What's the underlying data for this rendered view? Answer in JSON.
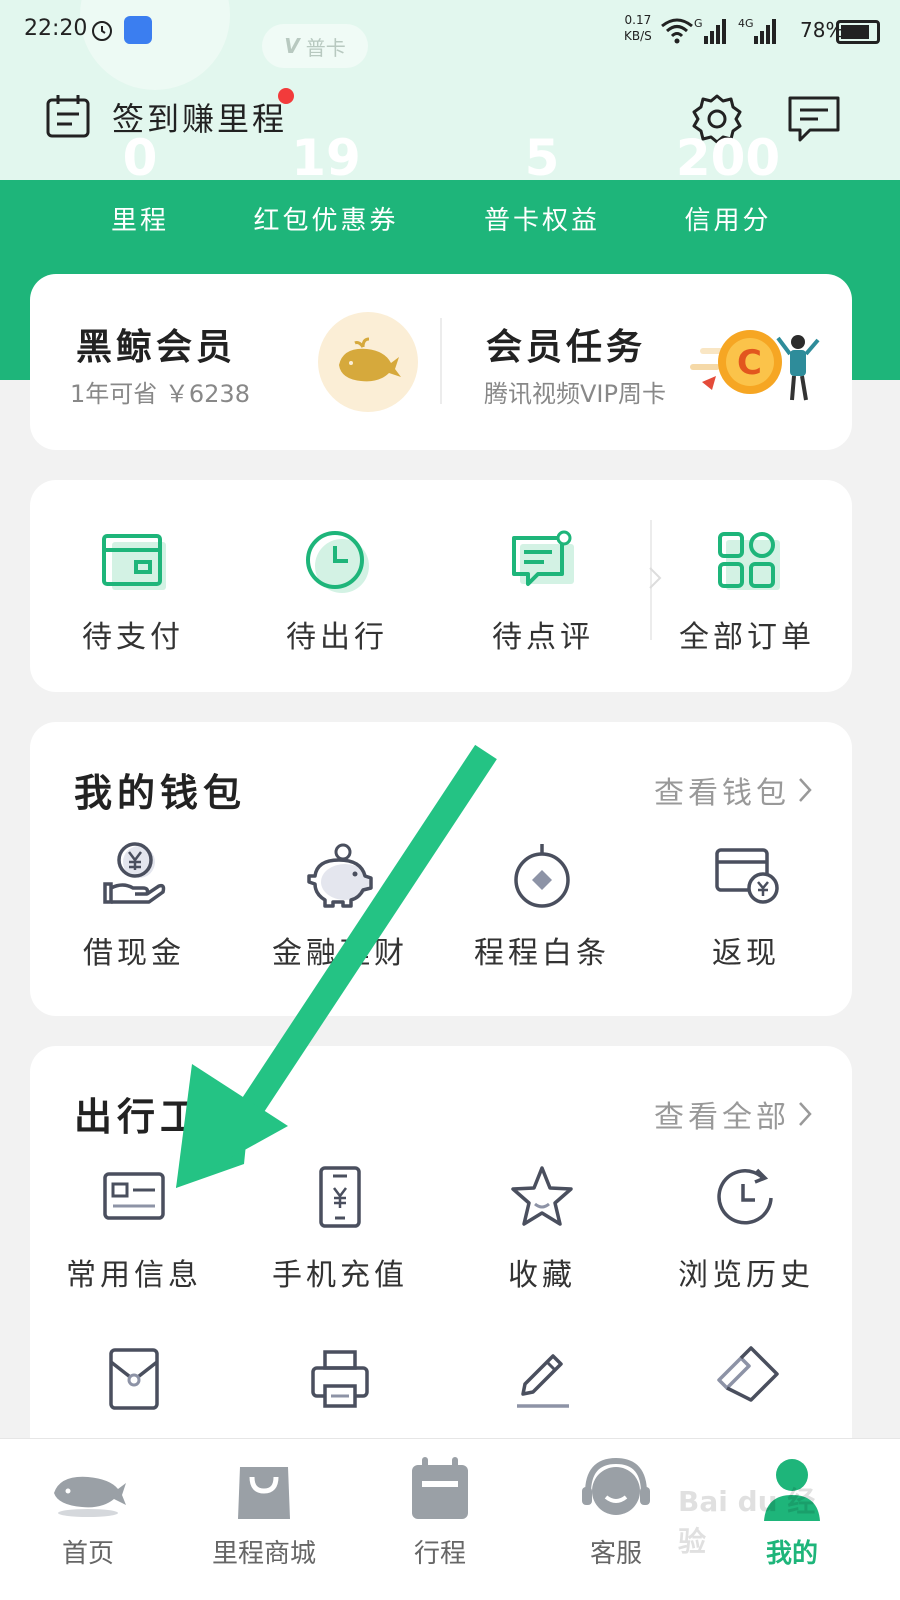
{
  "status_bar": {
    "time": "22:20",
    "speed_value": "0.17",
    "speed_unit": "KB/S",
    "network_1": "G",
    "network_2": "4G",
    "battery": "78%"
  },
  "vip_pill": {
    "letter": "V",
    "label": "普卡"
  },
  "header": {
    "checkin_label": "签到赚里程"
  },
  "stats": [
    {
      "value": "0",
      "label": "里程"
    },
    {
      "value": "19",
      "label": "红包优惠券"
    },
    {
      "value": "5",
      "label": "普卡权益"
    },
    {
      "value": "200",
      "label": "信用分"
    }
  ],
  "membership": {
    "title": "黑鲸会员",
    "subtitle": "1年可省 ￥6238",
    "task_title": "会员任务",
    "task_subtitle": "腾讯视频VIP周卡"
  },
  "orders": [
    {
      "label": "待支付",
      "icon": "wallet-card-icon"
    },
    {
      "label": "待出行",
      "icon": "clock-icon"
    },
    {
      "label": "待点评",
      "icon": "comment-icon"
    },
    {
      "label": "全部订单",
      "icon": "grid-icon"
    }
  ],
  "wallet": {
    "title": "我的钱包",
    "link": "查看钱包",
    "items": [
      {
        "label": "借现金",
        "icon": "cash-hand-icon"
      },
      {
        "label": "金融理财",
        "icon": "piggy-bank-icon"
      },
      {
        "label": "程程白条",
        "icon": "credit-circle-icon"
      },
      {
        "label": "返现",
        "icon": "cashback-card-icon"
      }
    ]
  },
  "tools": {
    "title": "出行工具",
    "link": "查看全部",
    "items": [
      {
        "label": "常用信息",
        "icon": "id-card-icon"
      },
      {
        "label": "手机充值",
        "icon": "phone-recharge-icon"
      },
      {
        "label": "收藏",
        "icon": "star-icon"
      },
      {
        "label": "浏览历史",
        "icon": "history-icon"
      }
    ],
    "row2_icons": [
      "envelope-icon",
      "printer-icon",
      "pen-icon",
      "ticket-icon"
    ]
  },
  "bottom_nav": [
    {
      "label": "首页",
      "icon": "whale-home-icon"
    },
    {
      "label": "里程商城",
      "icon": "shopping-bag-icon"
    },
    {
      "label": "行程",
      "icon": "calendar-icon"
    },
    {
      "label": "客服",
      "icon": "headset-icon"
    },
    {
      "label": "我的",
      "icon": "user-icon",
      "active": true
    }
  ],
  "watermark": "Bai du 经验",
  "colors": {
    "brand_green": "#1eb57a",
    "annotation_arrow": "#24c384",
    "icon_stroke": "#4a4f5e"
  }
}
